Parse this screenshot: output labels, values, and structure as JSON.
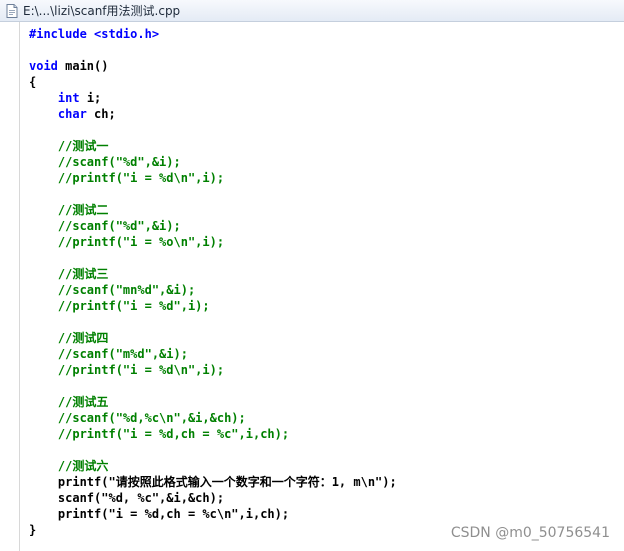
{
  "window": {
    "title": "E:\\...\\lizi\\scanf用法测试.cpp"
  },
  "colors": {
    "keyword": "#0000ff",
    "comment": "#008000",
    "plain": "#000000"
  },
  "code_lines": [
    [
      {
        "t": "#include <stdio.h>",
        "c": "kw"
      }
    ],
    [],
    [
      {
        "t": "void",
        "c": "kw"
      },
      {
        "t": " main()",
        "c": "pl"
      }
    ],
    [
      {
        "t": "{",
        "c": "pl"
      }
    ],
    [
      {
        "t": "    ",
        "c": "pl"
      },
      {
        "t": "int",
        "c": "kw"
      },
      {
        "t": " i;",
        "c": "pl"
      }
    ],
    [
      {
        "t": "    ",
        "c": "pl"
      },
      {
        "t": "char",
        "c": "kw"
      },
      {
        "t": " ch;",
        "c": "pl"
      }
    ],
    [],
    [
      {
        "t": "    //测试一",
        "c": "cm"
      }
    ],
    [
      {
        "t": "    //scanf(\"%d\",&i);",
        "c": "cm"
      }
    ],
    [
      {
        "t": "    //printf(\"i = %d\\n\",i);",
        "c": "cm"
      }
    ],
    [],
    [
      {
        "t": "    //测试二",
        "c": "cm"
      }
    ],
    [
      {
        "t": "    //scanf(\"%d\",&i);",
        "c": "cm"
      }
    ],
    [
      {
        "t": "    //printf(\"i = %o\\n\",i);",
        "c": "cm"
      }
    ],
    [],
    [
      {
        "t": "    //测试三",
        "c": "cm"
      }
    ],
    [
      {
        "t": "    //scanf(\"mn%d\",&i);",
        "c": "cm"
      }
    ],
    [
      {
        "t": "    //printf(\"i = %d\",i);",
        "c": "cm"
      }
    ],
    [],
    [
      {
        "t": "    //测试四",
        "c": "cm"
      }
    ],
    [
      {
        "t": "    //scanf(\"m%d\",&i);",
        "c": "cm"
      }
    ],
    [
      {
        "t": "    //printf(\"i = %d\\n\",i);",
        "c": "cm"
      }
    ],
    [],
    [
      {
        "t": "    //测试五",
        "c": "cm"
      }
    ],
    [
      {
        "t": "    //scanf(\"%d,%c\\n\",&i,&ch);",
        "c": "cm"
      }
    ],
    [
      {
        "t": "    //printf(\"i = %d,ch = %c\",i,ch);",
        "c": "cm"
      }
    ],
    [],
    [
      {
        "t": "    //测试六",
        "c": "cm"
      }
    ],
    [
      {
        "t": "    printf(\"请按照此格式输入一个数字和一个字符：1, m\\n\");",
        "c": "pl"
      }
    ],
    [
      {
        "t": "    scanf(\"%d, %c\",&i,&ch);",
        "c": "pl"
      }
    ],
    [
      {
        "t": "    printf(\"i = %d,ch = %c\\n\",i,ch);",
        "c": "pl"
      }
    ],
    [
      {
        "t": "}",
        "c": "pl"
      }
    ]
  ],
  "watermark": "CSDN @m0_50756541"
}
